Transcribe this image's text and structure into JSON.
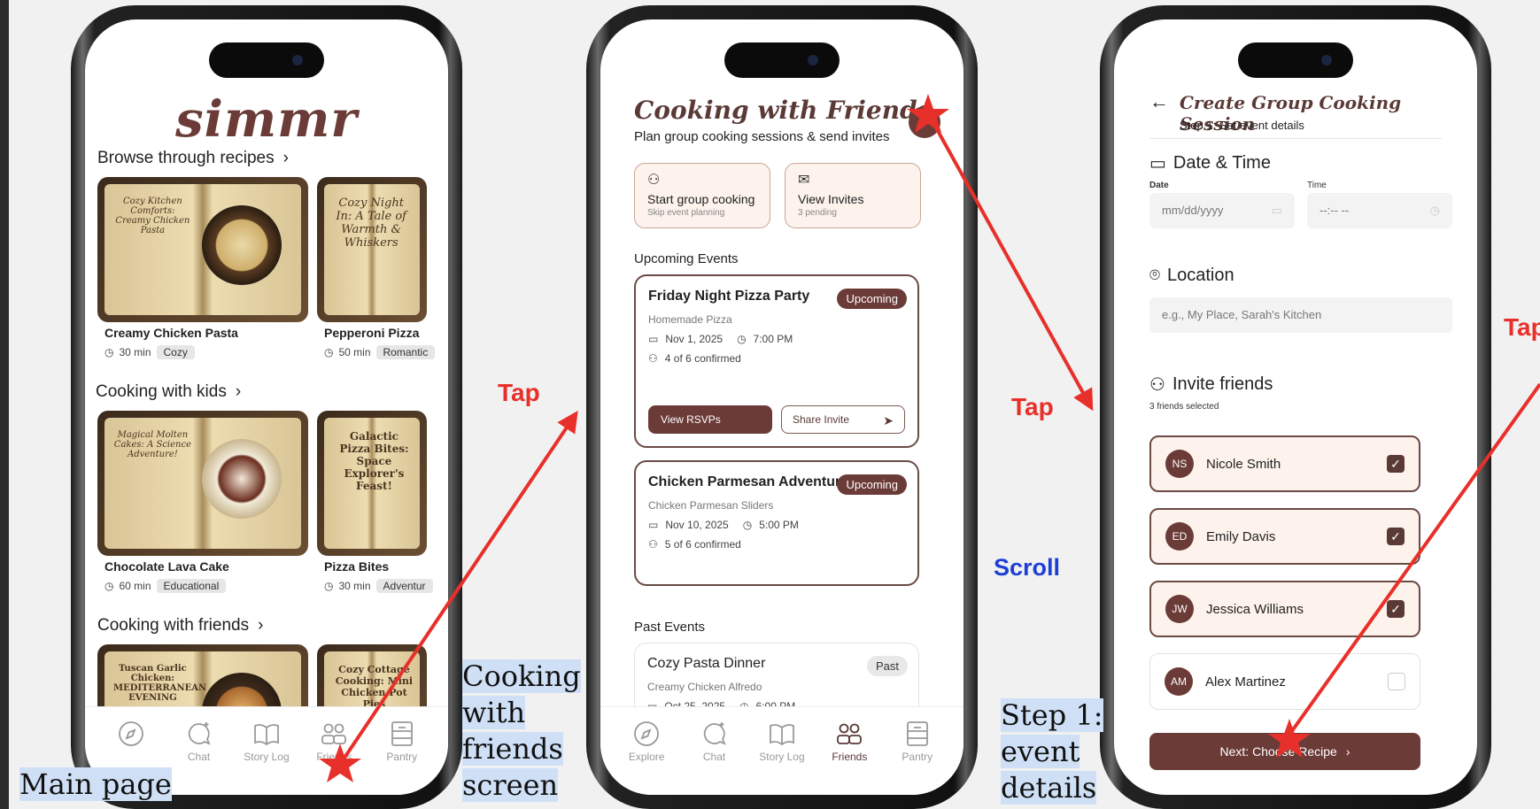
{
  "screen1": {
    "logo": "simmr",
    "browse_title": "Browse through recipes",
    "kids_title": "Cooking with kids",
    "friends_title": "Cooking with friends",
    "browse": [
      {
        "name": "Creamy Chicken Pasta",
        "time": "30 min",
        "tag": "Cozy",
        "book_text": "Cozy Kitchen Comforts: Creamy Chicken Pasta"
      },
      {
        "name": "Pepperoni Pizza",
        "time": "50 min",
        "tag": "Romantic",
        "book_text": "Cozy Night In: A Tale of Warmth & Whiskers"
      }
    ],
    "kids": [
      {
        "name": "Chocolate Lava Cake",
        "time": "60 min",
        "tag": "Educational",
        "book_text": "Magical Molten Cakes: A Science Adventure!"
      },
      {
        "name": "Pizza Bites",
        "time": "30 min",
        "tag": "Adventur",
        "book_text": "Galactic Pizza Bites: Space Explorer's Feast!"
      }
    ],
    "friends": [
      {
        "book_text": "Tuscan Garlic Chicken: MEDITERRANEAN EVENING"
      },
      {
        "book_text": "Cozy Cottage Cooking: Mini Chicken Pot Pies"
      }
    ]
  },
  "nav": [
    "Explore",
    "Chat",
    "Story Log",
    "Friends",
    "Pantry"
  ],
  "screen2": {
    "title": "Cooking with Friends",
    "subtitle": "Plan group cooking sessions & send invites",
    "quick": [
      {
        "title": "Start group cooking",
        "sub": "Skip event planning"
      },
      {
        "title": "View Invites",
        "sub": "3 pending"
      }
    ],
    "upcoming_label": "Upcoming Events",
    "events": [
      {
        "title": "Friday Night Pizza Party",
        "badge": "Upcoming",
        "recipe": "Homemade Pizza",
        "date": "Nov 1, 2025",
        "time": "7:00 PM",
        "confirmed": "4 of 6 confirmed",
        "rsvp_btn": "View RSVPs",
        "share_btn": "Share Invite"
      },
      {
        "title": "Chicken Parmesan Adventure",
        "badge": "Upcoming",
        "recipe": "Chicken Parmesan Sliders",
        "date": "Nov 10, 2025",
        "time": "5:00 PM",
        "confirmed": "5 of 6 confirmed"
      }
    ],
    "past_label": "Past Events",
    "past": {
      "title": "Cozy Pasta Dinner",
      "badge": "Past",
      "recipe": "Creamy Chicken Alfredo",
      "date": "Oct 25, 2025",
      "time": "6:00 PM"
    }
  },
  "screen3": {
    "title": "Create Group Cooking Session",
    "subtitle": "Step 1: Set event details",
    "datetime_label": "Date & Time",
    "date_label": "Date",
    "time_label": "Time",
    "date_placeholder": "mm/dd/yyyy",
    "time_placeholder": "--:-- --",
    "location_label": "Location",
    "location_placeholder": "e.g., My Place, Sarah's Kitchen",
    "invite_label": "Invite friends",
    "invite_count": "3 friends selected",
    "friends": [
      {
        "initials": "NS",
        "name": "Nicole Smith",
        "checked": true
      },
      {
        "initials": "ED",
        "name": "Emily Davis",
        "checked": true
      },
      {
        "initials": "JW",
        "name": "Jessica Williams",
        "checked": true
      },
      {
        "initials": "AM",
        "name": "Alex Martinez",
        "checked": false
      }
    ],
    "next_label": "Next: Choose Recipe"
  },
  "annotations": {
    "cap1": "Main page",
    "cap2": [
      "Cooking",
      "with",
      "friends",
      "screen"
    ],
    "cap3": [
      "Step 1:",
      "event",
      "details"
    ],
    "tap1": "Tap",
    "tap2": "Tap",
    "tap3": "Tap",
    "scroll": "Scroll"
  },
  "colors": {
    "brand": "#6b3b38",
    "annotation_red": "#e8302a",
    "annotation_blue": "#1d3fd6",
    "caption_highlight": "#cfe0f6"
  }
}
